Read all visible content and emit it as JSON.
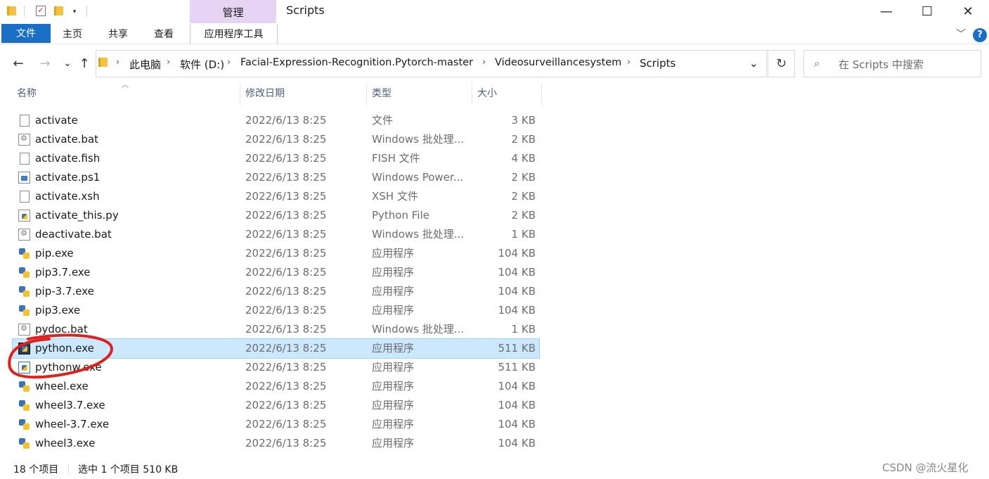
{
  "window": {
    "title": "Scripts",
    "context_tab": "管理",
    "controls": {
      "minimize": "—",
      "maximize": "☐",
      "close": "✕"
    }
  },
  "ribbon": {
    "tabs": [
      "文件",
      "主页",
      "共享",
      "查看",
      "应用程序工具"
    ],
    "help": "?",
    "collapse": "﹀"
  },
  "nav": {
    "back": "←",
    "forward": "→",
    "recent": "⌄",
    "up": "↑"
  },
  "breadcrumb": {
    "items": [
      "此电脑",
      "软件 (D:)",
      "Facial-Expression-Recognition.Pytorch-master",
      "Videosurveillancesystem",
      "Scripts"
    ],
    "separator": "›",
    "dropdown": "⌄",
    "refresh": "↻"
  },
  "search": {
    "placeholder": "在 Scripts 中搜索",
    "icon": "search-icon"
  },
  "columns": {
    "name": "名称",
    "modified": "修改日期",
    "type": "类型",
    "size": "大小"
  },
  "files": [
    {
      "name": "activate",
      "modified": "2022/6/13 8:25",
      "type": "文件",
      "size": "3 KB",
      "icon": "doc"
    },
    {
      "name": "activate.bat",
      "modified": "2022/6/13 8:25",
      "type": "Windows 批处理...",
      "size": "2 KB",
      "icon": "bat"
    },
    {
      "name": "activate.fish",
      "modified": "2022/6/13 8:25",
      "type": "FISH 文件",
      "size": "4 KB",
      "icon": "doc"
    },
    {
      "name": "activate.ps1",
      "modified": "2022/6/13 8:25",
      "type": "Windows Power...",
      "size": "2 KB",
      "icon": "ps"
    },
    {
      "name": "activate.xsh",
      "modified": "2022/6/13 8:25",
      "type": "XSH 文件",
      "size": "2 KB",
      "icon": "doc"
    },
    {
      "name": "activate_this.py",
      "modified": "2022/6/13 8:25",
      "type": "Python File",
      "size": "2 KB",
      "icon": "py"
    },
    {
      "name": "deactivate.bat",
      "modified": "2022/6/13 8:25",
      "type": "Windows 批处理...",
      "size": "1 KB",
      "icon": "bat"
    },
    {
      "name": "pip.exe",
      "modified": "2022/6/13 8:25",
      "type": "应用程序",
      "size": "104 KB",
      "icon": "exe"
    },
    {
      "name": "pip3.7.exe",
      "modified": "2022/6/13 8:25",
      "type": "应用程序",
      "size": "104 KB",
      "icon": "exe"
    },
    {
      "name": "pip-3.7.exe",
      "modified": "2022/6/13 8:25",
      "type": "应用程序",
      "size": "104 KB",
      "icon": "exe"
    },
    {
      "name": "pip3.exe",
      "modified": "2022/6/13 8:25",
      "type": "应用程序",
      "size": "104 KB",
      "icon": "exe"
    },
    {
      "name": "pydoc.bat",
      "modified": "2022/6/13 8:25",
      "type": "Windows 批处理...",
      "size": "1 KB",
      "icon": "bat"
    },
    {
      "name": "python.exe",
      "modified": "2022/6/13 8:25",
      "type": "应用程序",
      "size": "511 KB",
      "icon": "pyexe",
      "selected": true
    },
    {
      "name": "pythonw.exe",
      "modified": "2022/6/13 8:25",
      "type": "应用程序",
      "size": "511 KB",
      "icon": "pywexe"
    },
    {
      "name": "wheel.exe",
      "modified": "2022/6/13 8:25",
      "type": "应用程序",
      "size": "104 KB",
      "icon": "exe"
    },
    {
      "name": "wheel3.7.exe",
      "modified": "2022/6/13 8:25",
      "type": "应用程序",
      "size": "104 KB",
      "icon": "exe"
    },
    {
      "name": "wheel-3.7.exe",
      "modified": "2022/6/13 8:25",
      "type": "应用程序",
      "size": "104 KB",
      "icon": "exe"
    },
    {
      "name": "wheel3.exe",
      "modified": "2022/6/13 8:25",
      "type": "应用程序",
      "size": "104 KB",
      "icon": "exe"
    }
  ],
  "status": {
    "count": "18 个项目",
    "selection": "选中 1 个项目  510 KB"
  },
  "watermark": "CSDN @流火星化",
  "colors": {
    "accent": "#1a6fc4",
    "context_tab": "#e7d4f5",
    "selection": "#cce8ff",
    "annotation": "#e0201b"
  }
}
